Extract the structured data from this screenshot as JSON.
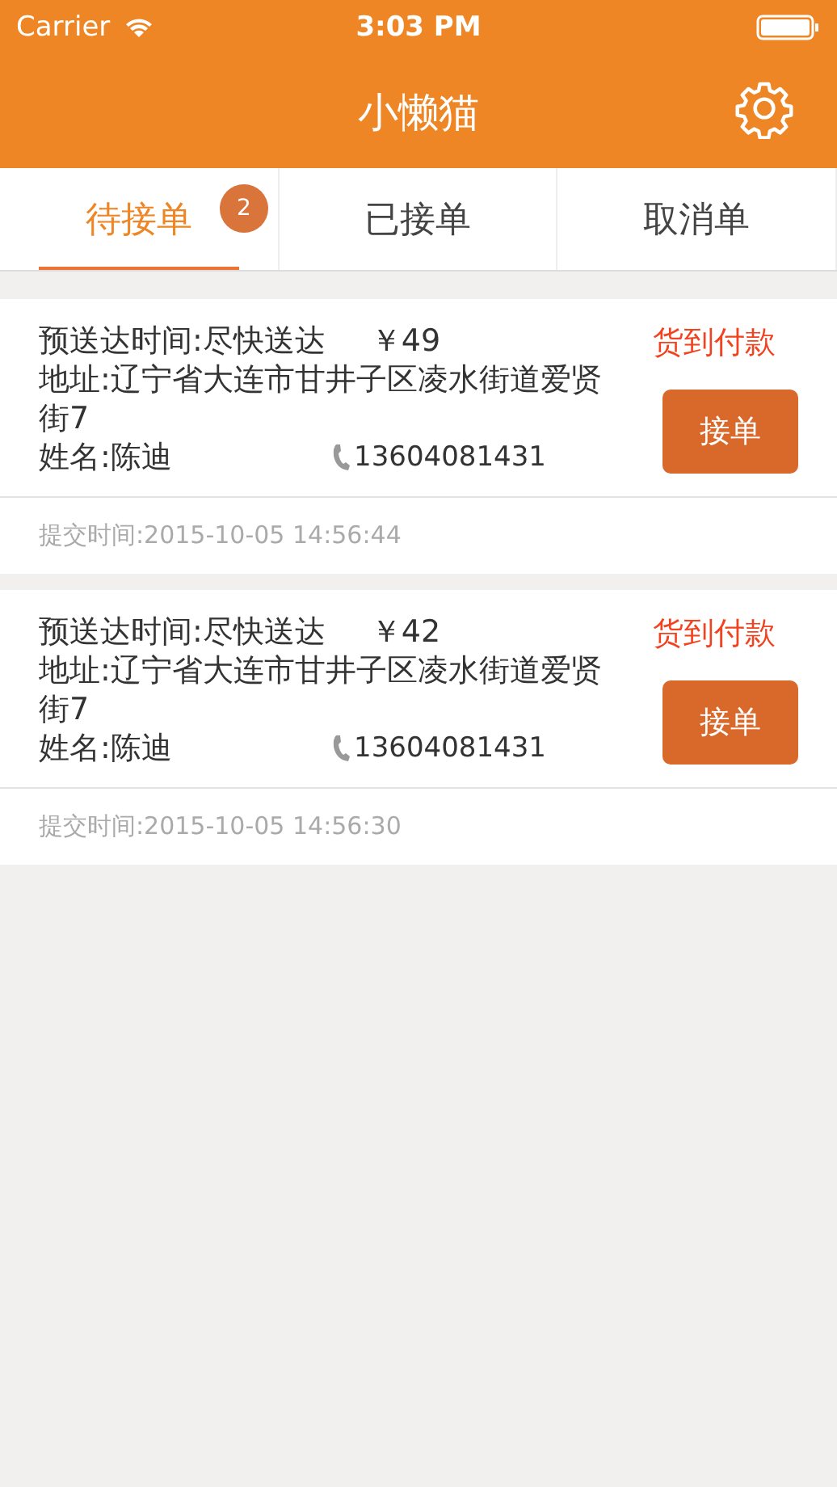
{
  "status_bar": {
    "carrier": "Carrier",
    "time": "3:03 PM"
  },
  "nav": {
    "title": "小懒猫"
  },
  "tabs": [
    {
      "label": "待接单",
      "selected": true,
      "badge": "2"
    },
    {
      "label": "已接单",
      "selected": false
    },
    {
      "label": "取消单",
      "selected": false
    }
  ],
  "orders": [
    {
      "delivery_time": "预送达时间:尽快送达",
      "price": "￥49",
      "payment": "货到付款",
      "address": "地址:辽宁省大连市甘井子区凌水街道爱贤街7",
      "name": "姓名:陈迪",
      "phone": "13604081431",
      "button": "接单",
      "submitted": "提交时间:2015-10-05 14:56:44"
    },
    {
      "delivery_time": "预送达时间:尽快送达",
      "price": "￥42",
      "payment": "货到付款",
      "address": "地址:辽宁省大连市甘井子区凌水街道爱贤街7",
      "name": "姓名:陈迪",
      "phone": "13604081431",
      "button": "接单",
      "submitted": "提交时间:2015-10-05 14:56:30"
    }
  ]
}
